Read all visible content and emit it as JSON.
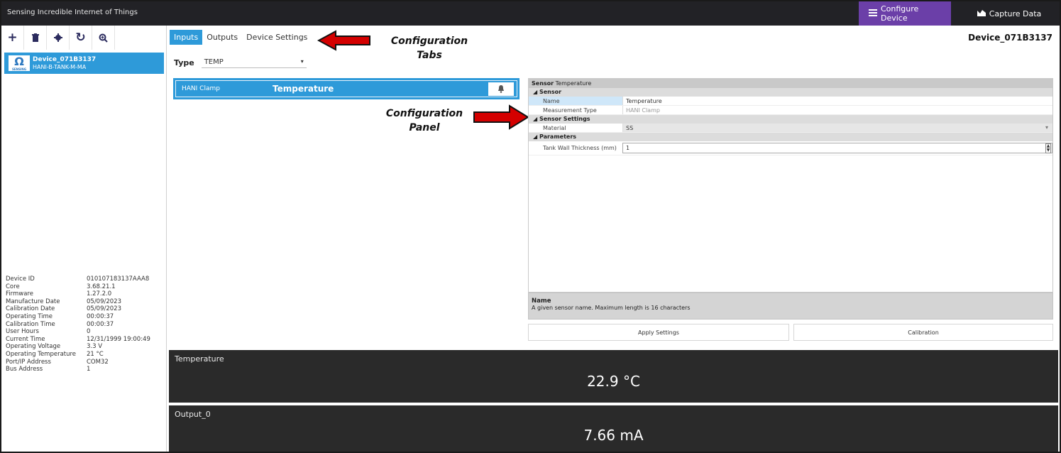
{
  "app": {
    "title": "Sensing Incredible Internet of Things",
    "modes": {
      "configure": "Configure Device",
      "capture": "Capture Data"
    }
  },
  "toolbar": {
    "icons": [
      "plus-icon",
      "trash-icon",
      "gear-icon",
      "refresh-icon",
      "zoom-icon"
    ]
  },
  "device_list": {
    "items": [
      {
        "name": "Device_071B3137",
        "model": "HANI-B-TANK-M-MA",
        "logo_text": "SENSING"
      }
    ]
  },
  "device_info": [
    {
      "key": "Device ID",
      "value": "010107183137AAA8"
    },
    {
      "key": "Core",
      "value": "3.68.21.1"
    },
    {
      "key": "Firmware",
      "value": "1.27.2.0"
    },
    {
      "key": "Manufacture Date",
      "value": "05/09/2023"
    },
    {
      "key": "Calibration Date",
      "value": "05/09/2023"
    },
    {
      "key": "Operating Time",
      "value": "00:00:37"
    },
    {
      "key": "Calibration Time",
      "value": "00:00:37"
    },
    {
      "key": "User Hours",
      "value": "0"
    },
    {
      "key": "Current Time",
      "value": "12/31/1999 19:00:49"
    },
    {
      "key": "Operating Voltage",
      "value": "3.3 V"
    },
    {
      "key": "Operating Temperature",
      "value": "21 °C"
    },
    {
      "key": "Port/IP Address",
      "value": "COM32"
    },
    {
      "key": "Bus Address",
      "value": "1"
    }
  ],
  "tabs": [
    {
      "label": "Inputs",
      "active": true
    },
    {
      "label": "Outputs",
      "active": false
    },
    {
      "label": "Device Settings",
      "active": false
    }
  ],
  "selected_device": "Device_071B3137",
  "annotations": {
    "tabs_line1": "Configuration",
    "tabs_line2": "Tabs",
    "panel_line1": "Configuration",
    "panel_line2": "Panel",
    "arrow_color": "#d40000"
  },
  "type_filter": {
    "label": "Type",
    "value": "TEMP"
  },
  "sensors": [
    {
      "type": "HANI Clamp",
      "name": "Temperature",
      "icon": "bell-icon"
    }
  ],
  "properties": {
    "header_label": "Sensor",
    "header_value": "Temperature",
    "categories": {
      "sensor": "Sensor",
      "sensor_settings": "Sensor Settings",
      "parameters": "Parameters"
    },
    "rows": {
      "name": {
        "key": "Name",
        "value": "Temperature"
      },
      "measurement_type": {
        "key": "Measurement Type",
        "value": "HANI Clamp"
      },
      "material": {
        "key": "Material",
        "value": "SS"
      },
      "tank_wall": {
        "key": "Tank Wall Thickness (mm)",
        "value": "1"
      }
    },
    "description_title": "Name",
    "description_text": "A given sensor name. Maximum length is 16 characters"
  },
  "actions": {
    "apply": "Apply Settings",
    "calibration": "Calibration"
  },
  "readouts": [
    {
      "label": "Temperature",
      "value": "22.9 °C"
    },
    {
      "label": "Output_0",
      "value": "7.66 mA"
    }
  ],
  "colors": {
    "accent": "#2e9ad9",
    "active_mode": "#6b3fa8",
    "titlebar": "#222226",
    "readout_bg": "#2a2a2a"
  }
}
